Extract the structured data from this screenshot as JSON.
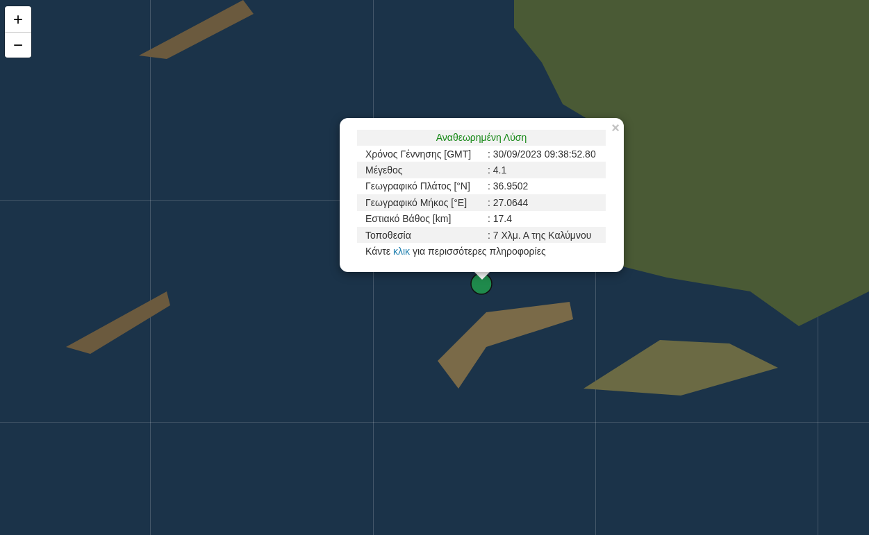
{
  "zoom_controls": {
    "zoom_in": "+",
    "zoom_out": "−"
  },
  "popup": {
    "close": "×",
    "title": "Αναθεωρημένη Λύση",
    "rows": [
      {
        "label": "Χρόνος Γέννησης [GMT]",
        "value": ": 30/09/2023 09:38:52.80"
      },
      {
        "label": "Μέγεθος",
        "value": ": 4.1"
      },
      {
        "label": "Γεωγραφικό Πλάτος [°N]",
        "value": ": 36.9502"
      },
      {
        "label": "Γεωγραφικό Μήκος [°E]",
        "value": ": 27.0644"
      },
      {
        "label": "Εστιακό Βάθος [km]",
        "value": ": 17.4"
      },
      {
        "label": "Τοποθεσία",
        "value": ": 7 Χλμ. Α της Καλύμνου"
      }
    ],
    "footer": {
      "before": "Κάντε",
      "link": "κλικ",
      "after": "για περισσότερες πληροφορίες"
    }
  }
}
